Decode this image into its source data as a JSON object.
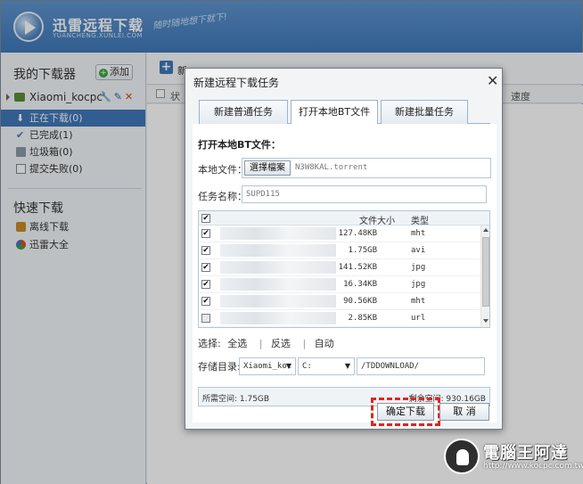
{
  "app": {
    "title": "迅雷远程下载",
    "subtitle": "YUANCHENG.XUNLEI.COM",
    "slogan": "随时随地想下就下!"
  },
  "sidebar": {
    "my_downloader": "我的下载器",
    "add_label": "添加",
    "device_name": "Xiaomi_kocpc",
    "items": [
      {
        "label": "正在下载(0)"
      },
      {
        "label": "已完成(1)"
      },
      {
        "label": "垃圾箱(0)"
      },
      {
        "label": "提交失败(0)"
      }
    ],
    "quick_title": "快速下载",
    "quick_items": [
      {
        "label": "离线下载"
      },
      {
        "label": "迅雷大全"
      }
    ]
  },
  "toolbar": {
    "new_label": "新",
    "col_status": "状",
    "col_speed": "速度"
  },
  "dialog": {
    "title": "新建远程下载任务",
    "tabs": [
      "新建普通任务",
      "打开本地BT文件",
      "新建批量任务"
    ],
    "section_title": "打开本地BT文件：",
    "local_file_label": "本地文件：",
    "choose_button": "選擇檔案",
    "file_name": "N3W8KAL.torrent",
    "task_name_label": "任务名称：",
    "task_name": "SUPD115",
    "file_list": {
      "col_size": "文件大小",
      "col_type": "类型",
      "rows": [
        {
          "size": "127.48KB",
          "type": "mht",
          "checked": "✔"
        },
        {
          "size": "1.75GB",
          "type": "avi",
          "checked": "✔"
        },
        {
          "size": "141.52KB",
          "type": "jpg",
          "checked": "✔"
        },
        {
          "size": "16.34KB",
          "type": "jpg",
          "checked": "✔"
        },
        {
          "size": "90.56KB",
          "type": "mht",
          "checked": "✔"
        },
        {
          "size": "2.85KB",
          "type": "url",
          "checked": ""
        }
      ]
    },
    "select_label": "选择:",
    "select_all": "全选",
    "select_invert": "反选",
    "select_auto": "自动",
    "save_dir_label": "存储目录:",
    "device_select": "Xiaomi_koc",
    "drive_select": "C:",
    "path": "/TDDOWNLOAD/",
    "need_space": "所需空间: 1.75GB",
    "free_space": "剩余空间: 930.16GB",
    "ok_button": "确定下载",
    "cancel_button": "取 消"
  },
  "watermark": {
    "text": "電腦王阿達",
    "url": "http://www.kocpc.com.tw"
  }
}
